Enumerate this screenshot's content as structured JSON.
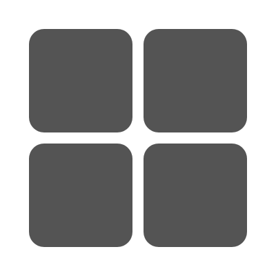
{
  "icon": {
    "name": "grid-icon",
    "color": "#545454",
    "background": "#ffffff",
    "tiles": [
      {
        "name": "grid-tile-top-left"
      },
      {
        "name": "grid-tile-top-right"
      },
      {
        "name": "grid-tile-bottom-left"
      },
      {
        "name": "grid-tile-bottom-right"
      }
    ]
  }
}
